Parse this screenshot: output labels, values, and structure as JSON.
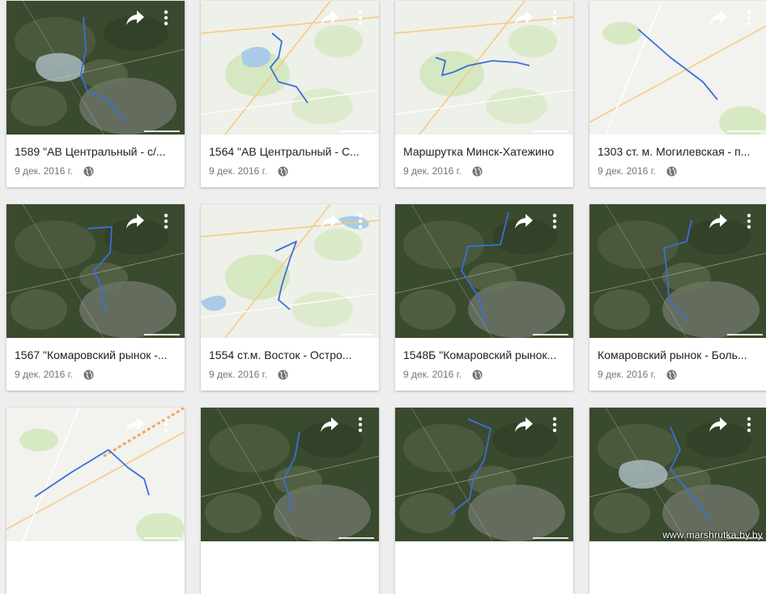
{
  "cards": [
    {
      "title": "1589 \"АВ Центральный - с/...",
      "date": "9 дек. 2016 г.",
      "map_style": "satellite"
    },
    {
      "title": "1564 \"АВ Центральный - С...",
      "date": "9 дек. 2016 г.",
      "map_style": "road"
    },
    {
      "title": "Маршрутка Минск-Хатежино",
      "date": "9 дек. 2016 г.",
      "map_style": "road"
    },
    {
      "title": "1303 ст. м. Могилевская - п...",
      "date": "9 дек. 2016 г.",
      "map_style": "road-light"
    },
    {
      "title": "1567 \"Комаровский рынок -...",
      "date": "9 дек. 2016 г.",
      "map_style": "satellite"
    },
    {
      "title": "1554 ст.м. Восток - Остро...",
      "date": "9 дек. 2016 г.",
      "map_style": "road"
    },
    {
      "title": "1548Б \"Комаровский рынок...",
      "date": "9 дек. 2016 г.",
      "map_style": "satellite"
    },
    {
      "title": "Комаровский рынок - Боль...",
      "date": "9 дек. 2016 г.",
      "map_style": "satellite"
    },
    {
      "title": "",
      "date": "",
      "map_style": "road-light"
    },
    {
      "title": "",
      "date": "",
      "map_style": "satellite"
    },
    {
      "title": "",
      "date": "",
      "map_style": "satellite"
    },
    {
      "title": "",
      "date": "",
      "map_style": "satellite"
    }
  ],
  "icons": {
    "share": "share-icon",
    "more": "more-vert-icon",
    "visibility": "globe-icon"
  },
  "colors": {
    "route": "#3b6fd8",
    "card_bg": "#ffffff",
    "page_bg": "#eeeeee",
    "satellite": "#3f4a32",
    "road": "#eef0ea"
  },
  "watermark": "www.marshrutka.by.by"
}
